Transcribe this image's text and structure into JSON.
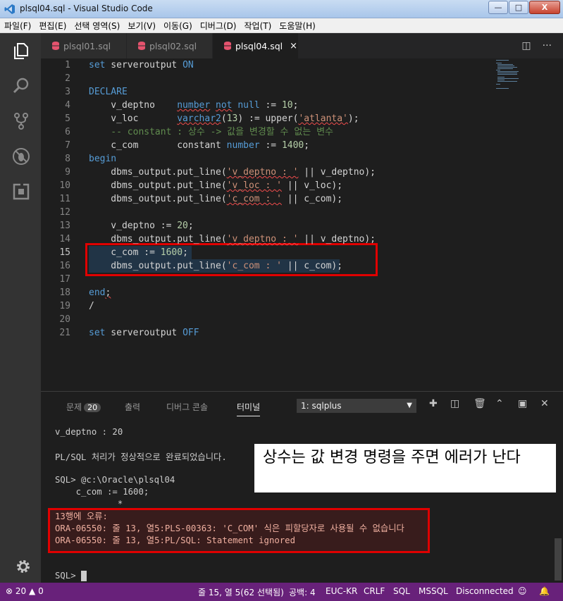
{
  "window": {
    "title": "plsql04.sql - Visual Studio Code",
    "minimize": "—",
    "maximize": "□",
    "close": "X"
  },
  "menu": [
    "파일(F)",
    "편집(E)",
    "선택 영역(S)",
    "보기(V)",
    "이동(G)",
    "디버그(D)",
    "작업(T)",
    "도움말(H)"
  ],
  "tabs": [
    {
      "label": "plsql01.sql"
    },
    {
      "label": "plsql02.sql"
    },
    {
      "label": "plsql04.sql",
      "close": "×"
    }
  ],
  "tab_actions": {
    "split": "◫",
    "more": "···"
  },
  "editor": {
    "line_numbers": [
      "1",
      "2",
      "3",
      "4",
      "5",
      "6",
      "7",
      "8",
      "9",
      "10",
      "11",
      "12",
      "13",
      "14",
      "15",
      "16",
      "17",
      "18",
      "19",
      "20",
      "21"
    ],
    "current_line": 15
  },
  "panel": {
    "tabs": [
      {
        "label": "문제",
        "badge": "20"
      },
      {
        "label": "출력"
      },
      {
        "label": "디버그 콘솔"
      },
      {
        "label": "터미널"
      }
    ],
    "terminal_select": "1: sqlplus",
    "terminal_lines": [
      "v_deptno : 20",
      "",
      "PL/SQL 처리가 정상적으로 완료되었습니다.",
      "",
      "SQL> @c:\\Oracle\\plsql04",
      "    c_com := 1600;",
      "            *",
      "13행에 오류:",
      "ORA-06550: 줄 13, 열5:PLS-00363: 'C_COM' 식은 피할당자로 사용될 수 없습니다",
      "ORA-06550: 줄 13, 열5:PL/SQL: Statement ignored",
      "",
      "",
      "SQL> "
    ]
  },
  "annotation": "상수는 값 변경 명령을 주면 에러가 난다",
  "status": {
    "errors": "20",
    "warnings": "0",
    "position": "줄 15, 열 5(62 선택됨)",
    "spaces": "공백: 4",
    "encoding": "EUC-KR",
    "eol": "CRLF",
    "language": "SQL",
    "dialect": "MSSQL",
    "connection": "Disconnected"
  },
  "colors": {
    "status_bar": "#68217a",
    "highlight_box": "#e00000",
    "keyword": "#569cd6",
    "string": "#ce9178"
  }
}
